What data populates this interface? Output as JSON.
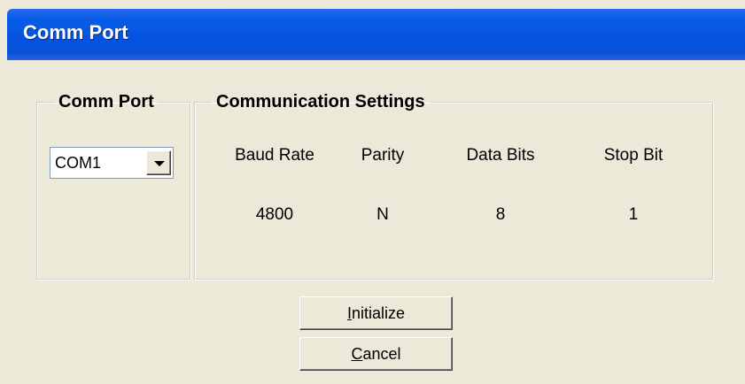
{
  "window": {
    "title": "Comm Port"
  },
  "comm_port_group": {
    "legend": "Comm Port",
    "port_select": {
      "value": "COM1"
    }
  },
  "settings_group": {
    "legend": "Communication Settings",
    "columns": [
      {
        "header": "Baud Rate",
        "value": "4800"
      },
      {
        "header": "Parity",
        "value": "N"
      },
      {
        "header": "Data Bits",
        "value": "8"
      },
      {
        "header": "Stop Bit",
        "value": "1"
      }
    ]
  },
  "buttons": {
    "initialize": {
      "mnemonic": "I",
      "rest": "nitialize"
    },
    "cancel": {
      "mnemonic": "C",
      "rest": "ancel"
    }
  }
}
